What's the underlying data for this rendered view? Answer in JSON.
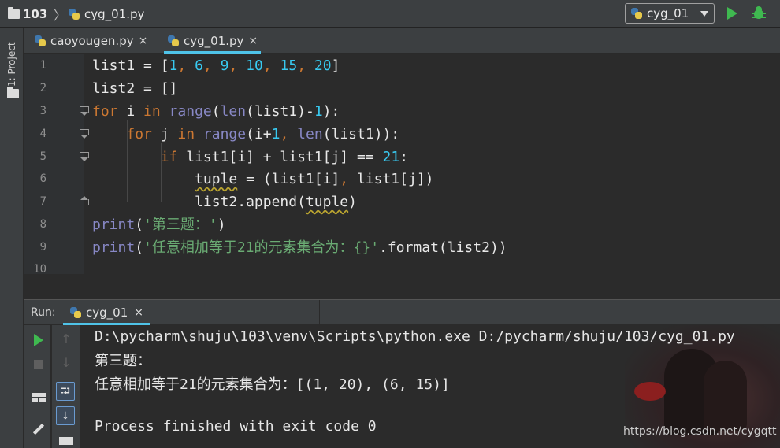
{
  "navbar": {
    "project": "103",
    "file": "cyg_01.py",
    "run_config": "cyg_01"
  },
  "sidebar": {
    "project_tab": "1: Project"
  },
  "tabs": [
    {
      "label": "caoyougen.py",
      "close": "×",
      "active": false
    },
    {
      "label": "cyg_01.py",
      "close": "×",
      "active": true
    }
  ],
  "editor": {
    "line_numbers": [
      "1",
      "2",
      "3",
      "4",
      "5",
      "6",
      "7",
      "8",
      "9",
      "10"
    ],
    "lines": [
      "list1 = [1, 6, 9, 10, 15, 20]",
      "list2 = []",
      "for i in range(len(list1)-1):",
      "    for j in range(i+1, len(list1)):",
      "        if list1[i] + list1[j] == 21:",
      "            tuple = (list1[i], list1[j])",
      "            list2.append(tuple)",
      "print('第三题：')",
      "print('任意相加等于21的元素集合为：{}'.format(list2))"
    ]
  },
  "run_panel": {
    "label": "Run:",
    "tab": "cyg_01",
    "close": "×"
  },
  "console": {
    "lines": [
      "D:\\pycharm\\shuju\\103\\venv\\Scripts\\python.exe D:/pycharm/shuju/103/cyg_01.py",
      "第三题：",
      "任意相加等于21的元素集合为：[(1, 20), (6, 15)]",
      "",
      "Process finished with exit code 0"
    ],
    "watermark": "https://blog.csdn.net/cygqtt"
  },
  "colors": {
    "keyword": "#cc7832",
    "builtin": "#8888c6",
    "number": "#38c9f0",
    "string": "#6aab73",
    "accent": "#4fc3e8",
    "run_green": "#3fb950"
  }
}
